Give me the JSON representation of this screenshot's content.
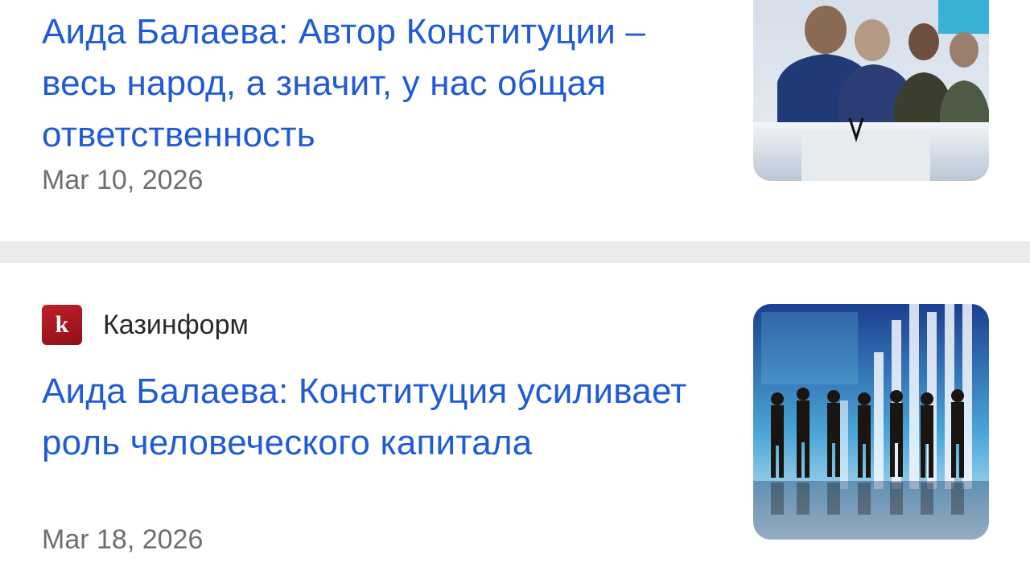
{
  "feed": {
    "items": [
      {
        "headline": "Аида Балаева: Автор Конституции – весь народ, а значит, у нас общая ответственность",
        "date": "Mar 10, 2026",
        "thumbnail": "news-photo-meeting"
      },
      {
        "source": {
          "logo_letter": "k",
          "name": "Казинформ",
          "logo_color": "#b01a24"
        },
        "headline": "Аида Балаева: Конституция усиливает роль человеческого капитала",
        "date": "Mar 18, 2026",
        "thumbnail": "news-photo-business-people"
      }
    ]
  },
  "colors": {
    "headline": "#1f5bd6",
    "date": "#6f6f6f",
    "divider": "#ebebeb"
  }
}
